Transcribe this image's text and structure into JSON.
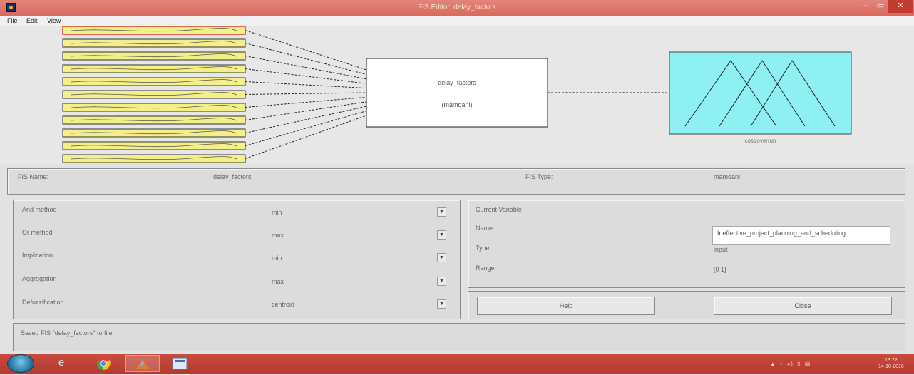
{
  "window": {
    "title": "FIS Editor: delay_factors",
    "minimize_glyph": "–",
    "maximize_glyph": "▭",
    "close_glyph": "✕",
    "app_icon": "matlab-icon"
  },
  "menu": [
    "File",
    "Edit",
    "View"
  ],
  "diagram": {
    "input_count": 11,
    "input_caption": "delay_factors",
    "system_name": "delay_factors",
    "system_type": "(mamdani)",
    "output_name": "cost/overrun",
    "colors": {
      "input_fill": "#f3f08a",
      "input_selected_border": "#e04a3a",
      "output_fill": "#8ff0f3",
      "system_fill": "#ffffff"
    }
  },
  "fis_info": {
    "name_label": "FIS Name:",
    "name_value": "delay_factors",
    "type_label": "FIS Type:",
    "type_value": "mamdani"
  },
  "methods": [
    {
      "label": "And method",
      "value": "min"
    },
    {
      "label": "Or method",
      "value": "max"
    },
    {
      "label": "Implication",
      "value": "min"
    },
    {
      "label": "Aggregation",
      "value": "max"
    },
    {
      "label": "Defuzzification",
      "value": "centroid"
    }
  ],
  "current_variable": {
    "heading": "Current Variable",
    "name_label": "Name",
    "name_value": "Ineffective_project_planning_and_scheduling",
    "type_label": "Type",
    "type_value": "input",
    "range_label": "Range",
    "range_value": "[0 1]"
  },
  "buttons": {
    "help": "Help",
    "close": "Close"
  },
  "status": "Saved FIS \"delay_factors\" to file",
  "taskbar": {
    "items": [
      "start-orb",
      "internet-explorer-icon",
      "chrome-icon",
      "matlab-icon",
      "fis-editor-icon"
    ],
    "time": "13:22",
    "date": "14-10-2016"
  }
}
